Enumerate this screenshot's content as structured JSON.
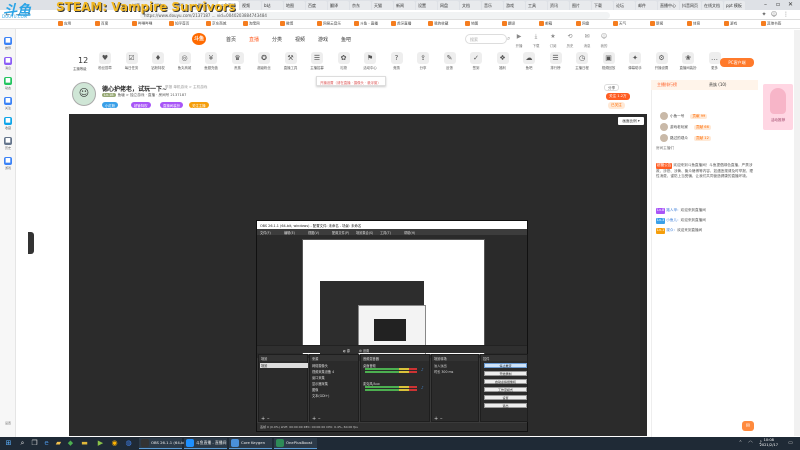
{
  "overlay": {
    "stream_text": "STEAM:  Vampire Survivors",
    "site_logo": "斗鱼",
    "site_sub": "DOUYU.COM"
  },
  "browser": {
    "tabs": [
      "抖音",
      "邮箱",
      "知乎",
      "微博",
      "斗鱼直播",
      "视频",
      "b站",
      "地图",
      "百度",
      "翻译",
      "京东",
      "天猫",
      "新闻",
      "设置",
      "网盘",
      "文档",
      "音乐",
      "游戏",
      "工具",
      "资讯",
      "图片",
      "下载",
      "论坛",
      "邮件",
      "直播中心",
      "抖音网页",
      "在线文档",
      "ppt 模板"
    ],
    "url": "https://www.douyu.com/2137187 ... vid=0040203884743484",
    "bookmarks": [
      "应用",
      "百度",
      "哔哩哔哩",
      "知乎首页",
      "京东商城",
      "淘宝网",
      "微博",
      "网易云音乐",
      "斗鱼 - 直播",
      "虎牙直播",
      "我的收藏",
      "地图",
      "翻译",
      "邮箱",
      "网盘",
      "天气",
      "新闻",
      "体育",
      "游戏",
      "其他书签"
    ]
  },
  "sidebar": {
    "items": [
      {
        "label": "推荐",
        "color": "#3b82f6"
      },
      {
        "label": "消息",
        "color": "#8b5cf6"
      },
      {
        "label": "动态",
        "color": "#22c55e"
      },
      {
        "label": "关注",
        "color": "#3b82f6"
      },
      {
        "label": "收藏",
        "color": "#0ea5e9"
      },
      {
        "label": "历史",
        "color": "#64748b"
      },
      {
        "label": "游戏",
        "color": "#3b82f6"
      }
    ],
    "bottom_label": "设置"
  },
  "header": {
    "logo": "斗鱼",
    "nav": [
      "首页",
      "直播",
      "分类",
      "视频",
      "游戏",
      "鱼吧"
    ],
    "active_nav": 1,
    "search_placeholder": "搜索",
    "icons": [
      {
        "label": "开播",
        "icon": "▶"
      },
      {
        "label": "下载",
        "icon": "⤓"
      },
      {
        "label": "订阅",
        "icon": "★"
      },
      {
        "label": "历史",
        "icon": "⟲"
      },
      {
        "label": "消息",
        "icon": "✉"
      },
      {
        "label": "我的",
        "icon": "☺"
      }
    ]
  },
  "categories": {
    "count": "12",
    "count_label": "主播等级",
    "items": [
      {
        "label": "粉丝勋章",
        "icon": "♥"
      },
      {
        "label": "每日任务",
        "icon": "☑"
      },
      {
        "label": "钻粉特权",
        "icon": "♦"
      },
      {
        "label": "鱼丸商城",
        "icon": "◎"
      },
      {
        "label": "鱼翅充值",
        "icon": "¥"
      },
      {
        "label": "贵族",
        "icon": "♛"
      },
      {
        "label": "超级粉丝",
        "icon": "✪"
      },
      {
        "label": "直播工具",
        "icon": "⚒"
      },
      {
        "label": "主播招募",
        "icon": "☰"
      },
      {
        "label": "礼物",
        "icon": "✿"
      },
      {
        "label": "活动中心",
        "icon": "⚑"
      },
      {
        "label": "竞猜",
        "icon": "?"
      },
      {
        "label": "分享",
        "icon": "⇪"
      },
      {
        "label": "反馈",
        "icon": "✎"
      },
      {
        "label": "签到",
        "icon": "✓"
      },
      {
        "label": "福利",
        "icon": "❖"
      },
      {
        "label": "鱼吧",
        "icon": "☁"
      },
      {
        "label": "排行榜",
        "icon": "☰"
      },
      {
        "label": "主播日程",
        "icon": "◷"
      },
      {
        "label": "视频回放",
        "icon": "▣"
      },
      {
        "label": "弹幕助手",
        "icon": "✦"
      },
      {
        "label": "开播设置",
        "icon": "⚙"
      },
      {
        "label": "直播间装扮",
        "icon": "❀"
      },
      {
        "label": "更多",
        "icon": "…"
      }
    ],
    "pc_button": "PC客户端",
    "tooltip": "开播设置（请在直播 · 摄像头 · 悬浮窗）"
  },
  "room": {
    "avatar": "☺",
    "title": "德心护佬老，试玩一下~",
    "title_sub": "举报   单机游戏 > 主机游戏",
    "level": "Lv.18",
    "meta": "鱼塘 > 独立游戏 · 直播 · 房间号 2137187",
    "tags": [
      {
        "label": "小红粉",
        "color": "#3aa0e8"
      },
      {
        "label": "超管特权",
        "color": "#a855f7"
      },
      {
        "label": "直播间装扮",
        "color": "#a855f7"
      },
      {
        "label": "关注主播",
        "color": "#f59e0b"
      }
    ],
    "actions": [
      {
        "label": "分享",
        "style": "border:1px solid #ddd;color:#555"
      },
      {
        "label": "关注 1.2万",
        "style": "background:#ff5d23;color:#fff"
      },
      {
        "label": "已关注",
        "style": "background:#ffe9d6;color:#ff6a00"
      }
    ]
  },
  "player": {
    "corner_button": "画面比例 ▾"
  },
  "obs": {
    "title": "OBS 26.1.1 (64-bit, windows) - 配置文件: 未命名 - 场景: 未命名",
    "menu": [
      "文件(F)",
      "编辑(E)",
      "视图(V)",
      "配置文件(P)",
      "场景集合(S)",
      "工具(T)",
      "帮助(H)"
    ],
    "toolbar": [
      "◐ 源",
      "⚙ 设置"
    ],
    "panels": {
      "scenes": {
        "title": "场景",
        "items": [
          "场景"
        ]
      },
      "sources": {
        "title": "来源",
        "items": [
          "网络摄像头",
          "视频采集设备 4",
          "窗口采集",
          "显示器采集",
          "图像",
          "文本(GDI+)"
        ]
      },
      "mixer": {
        "title": "音频混音器",
        "items": [
          "桌面音频",
          "麦克风/Aux"
        ]
      },
      "transitions": {
        "title": "场景转场",
        "items": [
          "淡入淡出",
          "时长 300 ms"
        ]
      },
      "controls": {
        "title": "控件",
        "buttons": [
          "停止推流",
          "开始录制",
          "启动虚拟摄像机",
          "工作室模式",
          "设置",
          "退出"
        ]
      }
    },
    "status": "丢帧 0 (0.0%)   LIVE: 00:00:00   REC: 00:00:00   CPU: 0.4%, 60.00 fps"
  },
  "chat": {
    "tabs": [
      "主播排行榜",
      "贵族 (10)"
    ],
    "active_tab": 0,
    "ranks": [
      {
        "name": "小鱼一号",
        "badge": "贡献 99"
      },
      {
        "name": "游戏老玩家",
        "badge": "贡献 66"
      },
      {
        "name": "路过的观众",
        "badge": "贡献 12"
      }
    ],
    "section": "房间主播们",
    "lines": [
      {
        "badge": "超管公告",
        "badge_color": "#ff5d23",
        "name": "",
        "text": "欢迎来到斗鱼直播间！斗鱼提倡绿色直播，严禁涉政、涉恐、涉黄、聚众赌博等内容，如遇违规请及时举报，理性消费，谨防上当受骗，让我们共同营造健康的直播环境。"
      },
      {
        "badge": "Lv.8",
        "badge_color": "#a855f7",
        "name": "路人甲：",
        "text": "欢迎来到直播间"
      },
      {
        "badge": "Lv.3",
        "badge_color": "#3aa0e8",
        "name": "小鱼儿：",
        "text": "欢迎来到直播间"
      },
      {
        "badge": "Lv.1",
        "badge_color": "#f59e0b",
        "name": "观众：",
        "text": "欢迎来到直播间"
      }
    ],
    "send_icon": "✉"
  },
  "ad": {
    "label": "活动推荐"
  },
  "taskbar": {
    "search_icon": "⌕",
    "apps": [
      {
        "label": "OBS 26.1.1 (64-bit)",
        "color": "#333"
      },
      {
        "label": "斗鱼直播 - 直播间",
        "color": "#1e90ff"
      },
      {
        "label": "Core Keygen",
        "color": "#4a90d9"
      },
      {
        "label": "OnePlusBoost",
        "color": "#2e8b57"
      }
    ],
    "time": "10:08",
    "date": "2021/2/17"
  }
}
